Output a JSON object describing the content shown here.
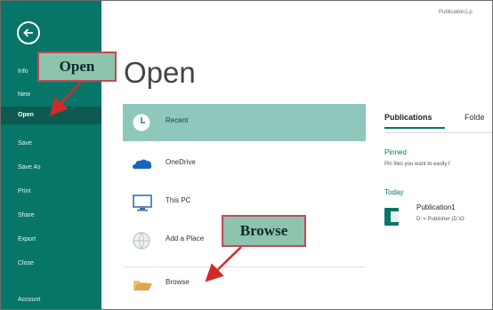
{
  "header": {
    "file_title": "Publication1.p"
  },
  "sidebar": {
    "items": [
      {
        "label": "Info"
      },
      {
        "label": "New"
      },
      {
        "label": "Open"
      },
      {
        "label": "Save"
      },
      {
        "label": "Save As"
      },
      {
        "label": "Print"
      },
      {
        "label": "Share"
      },
      {
        "label": "Export"
      },
      {
        "label": "Close"
      },
      {
        "label": "Account"
      }
    ]
  },
  "main": {
    "title": "Open",
    "locations": [
      {
        "label": "Recent",
        "icon": "clock-icon"
      },
      {
        "label": "OneDrive",
        "icon": "cloud-icon"
      },
      {
        "label": "This PC",
        "icon": "computer-icon"
      },
      {
        "label": "Add a Place",
        "icon": "globe-icon"
      },
      {
        "label": "Browse",
        "icon": "folder-icon"
      }
    ]
  },
  "right_panel": {
    "tabs": [
      {
        "label": "Publications"
      },
      {
        "label": "Folde"
      }
    ],
    "pinned_heading": "Pinned",
    "pinned_text": "Pin files you want to easily f",
    "today_heading": "Today",
    "recent_file": {
      "name": "Publication1",
      "path": "D: » Publisher (D:\\O"
    }
  },
  "callouts": {
    "open": "Open",
    "browse": "Browse"
  },
  "colors": {
    "sidebar_bg": "#077568",
    "selected_bg": "#8ec8bc",
    "callout_fill": "#8ec3ad",
    "callout_border": "#c04a55",
    "arrow": "#d12a2a"
  }
}
